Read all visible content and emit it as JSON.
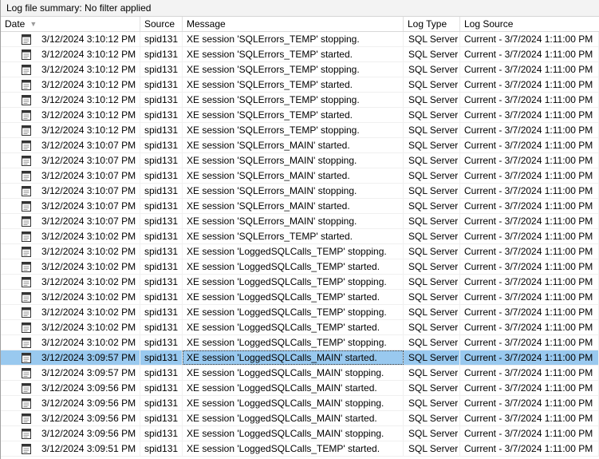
{
  "summary": "Log file summary: No filter applied",
  "columns": {
    "date": "Date",
    "source": "Source",
    "message": "Message",
    "log_type": "Log Type",
    "log_source": "Log Source"
  },
  "rows": [
    {
      "date": "3/12/2024 3:10:12 PM",
      "source": "spid131",
      "message": "XE session 'SQLErrors_TEMP' stopping.",
      "log_type": "SQL Server",
      "log_source": "Current - 3/7/2024 1:11:00 PM"
    },
    {
      "date": "3/12/2024 3:10:12 PM",
      "source": "spid131",
      "message": "XE session 'SQLErrors_TEMP' started.",
      "log_type": "SQL Server",
      "log_source": "Current - 3/7/2024 1:11:00 PM"
    },
    {
      "date": "3/12/2024 3:10:12 PM",
      "source": "spid131",
      "message": "XE session 'SQLErrors_TEMP' stopping.",
      "log_type": "SQL Server",
      "log_source": "Current - 3/7/2024 1:11:00 PM"
    },
    {
      "date": "3/12/2024 3:10:12 PM",
      "source": "spid131",
      "message": "XE session 'SQLErrors_TEMP' started.",
      "log_type": "SQL Server",
      "log_source": "Current - 3/7/2024 1:11:00 PM"
    },
    {
      "date": "3/12/2024 3:10:12 PM",
      "source": "spid131",
      "message": "XE session 'SQLErrors_TEMP' stopping.",
      "log_type": "SQL Server",
      "log_source": "Current - 3/7/2024 1:11:00 PM"
    },
    {
      "date": "3/12/2024 3:10:12 PM",
      "source": "spid131",
      "message": "XE session 'SQLErrors_TEMP' started.",
      "log_type": "SQL Server",
      "log_source": "Current - 3/7/2024 1:11:00 PM"
    },
    {
      "date": "3/12/2024 3:10:12 PM",
      "source": "spid131",
      "message": "XE session 'SQLErrors_TEMP' stopping.",
      "log_type": "SQL Server",
      "log_source": "Current - 3/7/2024 1:11:00 PM"
    },
    {
      "date": "3/12/2024 3:10:07 PM",
      "source": "spid131",
      "message": "XE session 'SQLErrors_MAIN' started.",
      "log_type": "SQL Server",
      "log_source": "Current - 3/7/2024 1:11:00 PM"
    },
    {
      "date": "3/12/2024 3:10:07 PM",
      "source": "spid131",
      "message": "XE session 'SQLErrors_MAIN' stopping.",
      "log_type": "SQL Server",
      "log_source": "Current - 3/7/2024 1:11:00 PM"
    },
    {
      "date": "3/12/2024 3:10:07 PM",
      "source": "spid131",
      "message": "XE session 'SQLErrors_MAIN' started.",
      "log_type": "SQL Server",
      "log_source": "Current - 3/7/2024 1:11:00 PM"
    },
    {
      "date": "3/12/2024 3:10:07 PM",
      "source": "spid131",
      "message": "XE session 'SQLErrors_MAIN' stopping.",
      "log_type": "SQL Server",
      "log_source": "Current - 3/7/2024 1:11:00 PM"
    },
    {
      "date": "3/12/2024 3:10:07 PM",
      "source": "spid131",
      "message": "XE session 'SQLErrors_MAIN' started.",
      "log_type": "SQL Server",
      "log_source": "Current - 3/7/2024 1:11:00 PM"
    },
    {
      "date": "3/12/2024 3:10:07 PM",
      "source": "spid131",
      "message": "XE session 'SQLErrors_MAIN' stopping.",
      "log_type": "SQL Server",
      "log_source": "Current - 3/7/2024 1:11:00 PM"
    },
    {
      "date": "3/12/2024 3:10:02 PM",
      "source": "spid131",
      "message": "XE session 'SQLErrors_TEMP' started.",
      "log_type": "SQL Server",
      "log_source": "Current - 3/7/2024 1:11:00 PM"
    },
    {
      "date": "3/12/2024 3:10:02 PM",
      "source": "spid131",
      "message": "XE session 'LoggedSQLCalls_TEMP' stopping.",
      "log_type": "SQL Server",
      "log_source": "Current - 3/7/2024 1:11:00 PM"
    },
    {
      "date": "3/12/2024 3:10:02 PM",
      "source": "spid131",
      "message": "XE session 'LoggedSQLCalls_TEMP' started.",
      "log_type": "SQL Server",
      "log_source": "Current - 3/7/2024 1:11:00 PM"
    },
    {
      "date": "3/12/2024 3:10:02 PM",
      "source": "spid131",
      "message": "XE session 'LoggedSQLCalls_TEMP' stopping.",
      "log_type": "SQL Server",
      "log_source": "Current - 3/7/2024 1:11:00 PM"
    },
    {
      "date": "3/12/2024 3:10:02 PM",
      "source": "spid131",
      "message": "XE session 'LoggedSQLCalls_TEMP' started.",
      "log_type": "SQL Server",
      "log_source": "Current - 3/7/2024 1:11:00 PM"
    },
    {
      "date": "3/12/2024 3:10:02 PM",
      "source": "spid131",
      "message": "XE session 'LoggedSQLCalls_TEMP' stopping.",
      "log_type": "SQL Server",
      "log_source": "Current - 3/7/2024 1:11:00 PM"
    },
    {
      "date": "3/12/2024 3:10:02 PM",
      "source": "spid131",
      "message": "XE session 'LoggedSQLCalls_TEMP' started.",
      "log_type": "SQL Server",
      "log_source": "Current - 3/7/2024 1:11:00 PM"
    },
    {
      "date": "3/12/2024 3:10:02 PM",
      "source": "spid131",
      "message": "XE session 'LoggedSQLCalls_TEMP' stopping.",
      "log_type": "SQL Server",
      "log_source": "Current - 3/7/2024 1:11:00 PM"
    },
    {
      "date": "3/12/2024 3:09:57 PM",
      "source": "spid131",
      "message": "XE session 'LoggedSQLCalls_MAIN' started.",
      "log_type": "SQL Server",
      "log_source": "Current - 3/7/2024 1:11:00 PM",
      "selected": true
    },
    {
      "date": "3/12/2024 3:09:57 PM",
      "source": "spid131",
      "message": "XE session 'LoggedSQLCalls_MAIN' stopping.",
      "log_type": "SQL Server",
      "log_source": "Current - 3/7/2024 1:11:00 PM"
    },
    {
      "date": "3/12/2024 3:09:56 PM",
      "source": "spid131",
      "message": "XE session 'LoggedSQLCalls_MAIN' started.",
      "log_type": "SQL Server",
      "log_source": "Current - 3/7/2024 1:11:00 PM"
    },
    {
      "date": "3/12/2024 3:09:56 PM",
      "source": "spid131",
      "message": "XE session 'LoggedSQLCalls_MAIN' stopping.",
      "log_type": "SQL Server",
      "log_source": "Current - 3/7/2024 1:11:00 PM"
    },
    {
      "date": "3/12/2024 3:09:56 PM",
      "source": "spid131",
      "message": "XE session 'LoggedSQLCalls_MAIN' started.",
      "log_type": "SQL Server",
      "log_source": "Current - 3/7/2024 1:11:00 PM"
    },
    {
      "date": "3/12/2024 3:09:56 PM",
      "source": "spid131",
      "message": "XE session 'LoggedSQLCalls_MAIN' stopping.",
      "log_type": "SQL Server",
      "log_source": "Current - 3/7/2024 1:11:00 PM"
    },
    {
      "date": "3/12/2024 3:09:51 PM",
      "source": "spid131",
      "message": "XE session 'LoggedSQLCalls_TEMP' started.",
      "log_type": "SQL Server",
      "log_source": "Current - 3/7/2024 1:11:00 PM"
    }
  ],
  "row_icon": "log-entry-icon",
  "colors": {
    "selected_row": "#99c9ef",
    "summary_bar": "#f3f3f3"
  }
}
